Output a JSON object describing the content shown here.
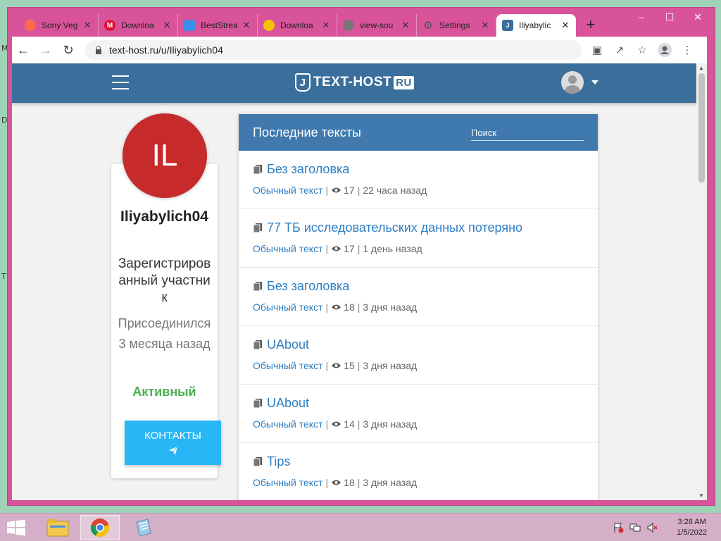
{
  "browser": {
    "tabs": [
      {
        "label": "Sony Veg",
        "favicon_color": "#ff6b4a",
        "favicon_char": ""
      },
      {
        "label": "Downloa",
        "favicon_color": "#e0103a",
        "favicon_char": "M"
      },
      {
        "label": "BestStrea",
        "favicon_color": "#3b8ee8",
        "favicon_char": ""
      },
      {
        "label": "Downloa",
        "favicon_color": "#f5c400",
        "favicon_char": ""
      },
      {
        "label": "view-sou",
        "favicon_color": "#777777",
        "favicon_char": ""
      },
      {
        "label": "Settings",
        "favicon_color": "#666666",
        "favicon_char": ""
      },
      {
        "label": "Iliyabylic",
        "favicon_color": "#3b6f9b",
        "favicon_char": ""
      }
    ],
    "new_tab_label": "+",
    "url": "text-host.ru/u/Iliyabylich04"
  },
  "site": {
    "logo_text": "TEXT-HOST",
    "logo_badge": "RU",
    "logo_mark": "J",
    "header_color": "#3b6f9b"
  },
  "profile": {
    "initials": "IL",
    "avatar_color": "#c62a2a",
    "username": "Iliyabylich04",
    "role": "Зарегистрированный участник",
    "joined": "Присоединился 3 месяца назад",
    "status": "Активный",
    "contacts_label": "КОНТАКТЫ"
  },
  "texts": {
    "title": "Последние тексты",
    "search_placeholder": "Поиск",
    "items": [
      {
        "title": "Без заголовка",
        "type": "Обычный текст",
        "views": "17",
        "age": "22 часа назад"
      },
      {
        "title": "77 ТБ исследовательских данных потеряно",
        "type": "Обычный текст",
        "views": "17",
        "age": "1 день назад"
      },
      {
        "title": "Без заголовка",
        "type": "Обычный текст",
        "views": "18",
        "age": "3 дня назад"
      },
      {
        "title": "UAbout",
        "type": "Обычный текст",
        "views": "15",
        "age": "3 дня назад"
      },
      {
        "title": "UAbout",
        "type": "Обычный текст",
        "views": "14",
        "age": "3 дня назад"
      },
      {
        "title": "Tips",
        "type": "Обычный текст",
        "views": "18",
        "age": "3 дня назад"
      }
    ]
  },
  "taskbar": {
    "time": "3:28 AM",
    "date": "1/5/2022"
  },
  "desktop": {
    "glyphs": [
      "M",
      "D",
      "T"
    ]
  }
}
